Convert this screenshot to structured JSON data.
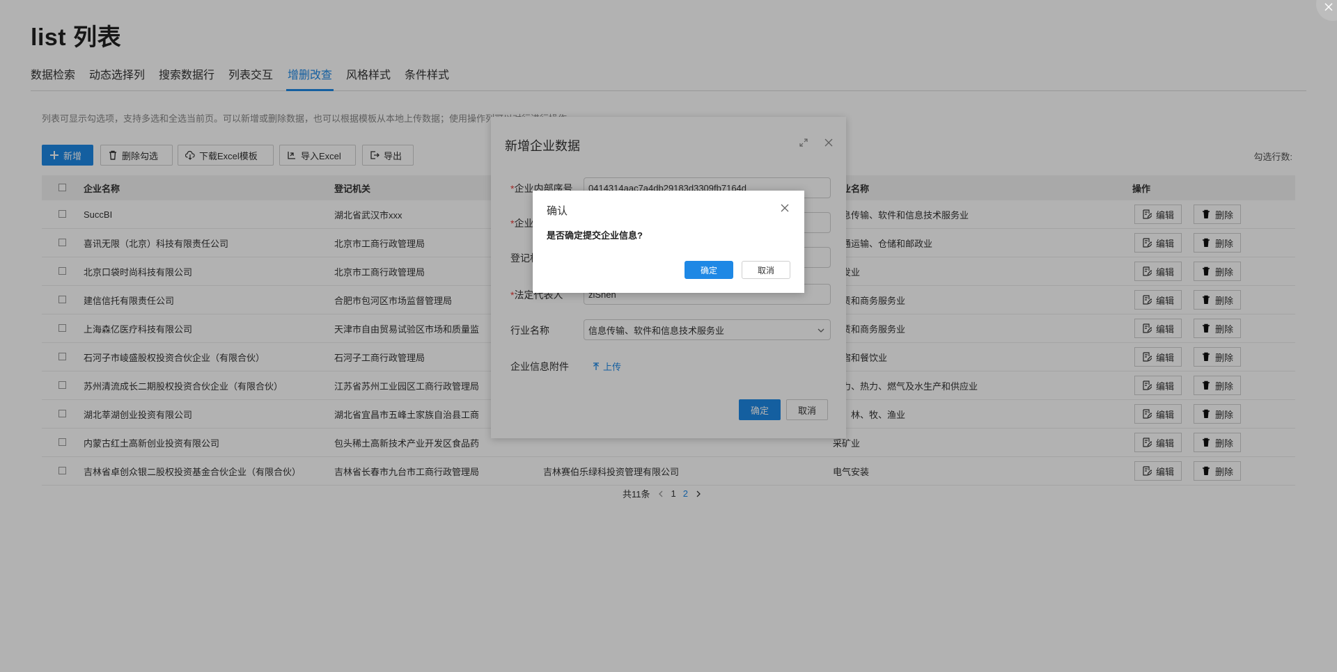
{
  "page": {
    "title": "list 列表",
    "tabs": [
      "数据检索",
      "动态选择列",
      "搜索数据行",
      "列表交互",
      "增删改查",
      "风格样式",
      "条件样式"
    ],
    "active_tab": 4,
    "description": "列表可显示勾选项，支持多选和全选当前页。可以新增或删除数据，也可以根据模板从本地上传数据；使用操作列可以对行进行操作。",
    "toolbar": {
      "add": "新增",
      "delete_selected": "删除勾选",
      "download_template": "下载Excel模板",
      "import_excel": "导入Excel",
      "export": "导出"
    },
    "selected_count_label": "勾选行数:"
  },
  "table": {
    "columns": [
      "企业名称",
      "登记机关",
      "",
      "行业名称",
      "操作"
    ],
    "rows": [
      [
        "SuccBI",
        "湖北省武汉市xxx",
        "",
        "信息传输、软件和信息技术服务业"
      ],
      [
        "喜讯无限（北京）科技有限责任公司",
        "北京市工商行政管理局",
        "",
        "交通运输、仓储和邮政业"
      ],
      [
        "北京口袋时尚科技有限公司",
        "北京市工商行政管理局",
        "",
        "批发业"
      ],
      [
        "建信信托有限责任公司",
        "合肥市包河区市场监督管理局",
        "",
        "租赁和商务服务业"
      ],
      [
        "上海森亿医疗科技有限公司",
        "天津市自由贸易试验区市场和质量监",
        "",
        "租赁和商务服务业"
      ],
      [
        "石河子市崚盛股权投资合伙企业（有限合伙）",
        "石河子工商行政管理局",
        "",
        "住宿和餐饮业"
      ],
      [
        "苏州清流成长二期股权投资合伙企业（有限合伙）",
        "江苏省苏州工业园区工商行政管理局",
        "",
        "电力、热力、燃气及水生产和供应业"
      ],
      [
        "湖北莘湖创业投资有限公司",
        "湖北省宜昌市五峰土家族自治县工商",
        "",
        "农、林、牧、渔业"
      ],
      [
        "内蒙古红土高新创业投资有限公司",
        "包头稀土高新技术产业开发区食品药",
        "",
        "采矿业"
      ],
      [
        "吉林省卓创众银二股权投资基金合伙企业（有限合伙）",
        "吉林省长春市九台市工商行政管理局",
        "吉林赛伯乐绿科投资管理有限公司",
        "电气安装"
      ]
    ],
    "edit_label": "编辑",
    "delete_label": "删除"
  },
  "pager": {
    "total": "共11条",
    "page1": "1",
    "page2": "2"
  },
  "add_dialog": {
    "title": "新增企业数据",
    "fields": [
      {
        "label": "企业内部序号",
        "required": true,
        "value": "0414314aac7a4db29183d3309fb7164d"
      },
      {
        "label": "企业",
        "required": true,
        "value": ""
      },
      {
        "label": "登记机关",
        "required": false,
        "value": ""
      },
      {
        "label": "法定代表人",
        "required": true,
        "value": "zlShen"
      },
      {
        "label": "行业名称",
        "required": false,
        "value": "信息传输、软件和信息技术服务业"
      }
    ],
    "attachment_label": "企业信息附件",
    "upload_label": "上传",
    "ok": "确定",
    "cancel": "取消"
  },
  "confirm_dialog": {
    "title": "确认",
    "message": "是否确定提交企业信息?",
    "ok": "确定",
    "cancel": "取消"
  },
  "colors": {
    "accent": "#1e88e5",
    "required": "#e53935"
  }
}
